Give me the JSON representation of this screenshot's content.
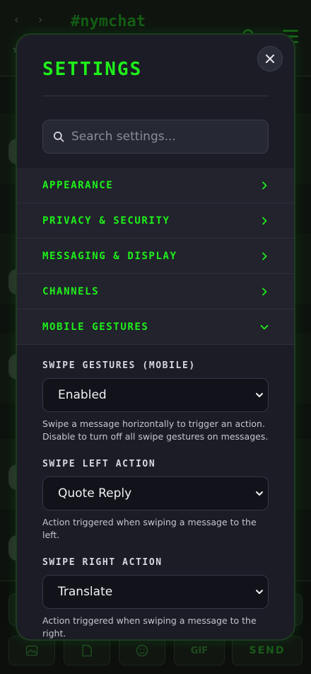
{
  "background": {
    "channel_title": "#nymchat",
    "back_icon": "chevron-left-icon",
    "forward_icon": "chevron-right-icon",
    "send_label": "SEND",
    "gif_label": "GIF"
  },
  "modal": {
    "title": "SETTINGS",
    "close_icon": "close-icon",
    "search": {
      "placeholder": "Search settings..."
    },
    "sections": [
      {
        "label": "APPEARANCE",
        "state": "collapsed"
      },
      {
        "label": "PRIVACY & SECURITY",
        "state": "collapsed"
      },
      {
        "label": "MESSAGING & DISPLAY",
        "state": "collapsed"
      },
      {
        "label": "CHANNELS",
        "state": "collapsed"
      },
      {
        "label": "MOBILE GESTURES",
        "state": "expanded"
      }
    ],
    "mobile_gestures": {
      "swipe_gestures": {
        "label": "SWIPE GESTURES (MOBILE)",
        "value": "Enabled",
        "help": "Swipe a message horizontally to trigger an action. Disable to turn off all swipe gestures on messages."
      },
      "swipe_left": {
        "label": "SWIPE LEFT ACTION",
        "value": "Quote Reply",
        "help": "Action triggered when swiping a message to the left."
      },
      "swipe_right": {
        "label": "SWIPE RIGHT ACTION",
        "value": "Translate",
        "help": "Action triggered when swiping a message to the right."
      }
    }
  },
  "colors": {
    "accent": "#1ff01a",
    "modal_bg": "#1b1c26",
    "select_bg": "#11121a"
  }
}
